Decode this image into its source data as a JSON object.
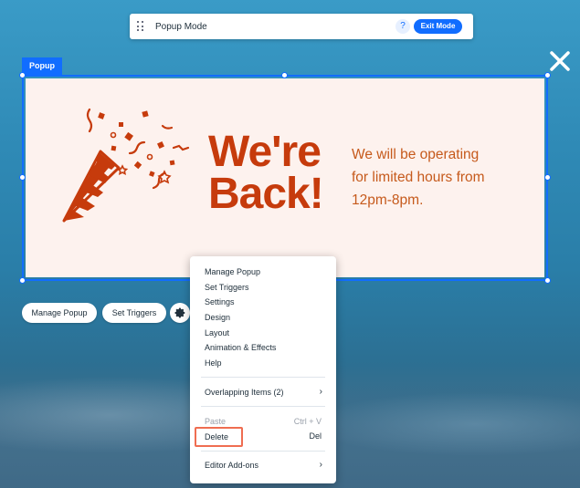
{
  "mode_bar": {
    "title": "Popup Mode",
    "help_label": "?",
    "exit_label": "Exit Mode"
  },
  "popup": {
    "tag_label": "Popup",
    "headline_line1": "We're",
    "headline_line2": "Back!",
    "body_line1": "We will be operating",
    "body_line2": "for limited hours from",
    "body_line3": "12pm-8pm.",
    "illustration": "party-popper-confetti",
    "background_color": "#fdf2ee",
    "accent_color": "#c63b0c"
  },
  "actions": {
    "manage_popup_label": "Manage Popup",
    "set_triggers_label": "Set Triggers",
    "icons": [
      "gear-icon",
      "layout-icon",
      "animation-icon",
      "arrow-icon",
      "help-icon"
    ]
  },
  "context_menu": {
    "items": [
      {
        "label": "Manage Popup"
      },
      {
        "label": "Set Triggers"
      },
      {
        "label": "Settings"
      },
      {
        "label": "Design"
      },
      {
        "label": "Layout"
      },
      {
        "label": "Animation & Effects"
      },
      {
        "label": "Help"
      }
    ],
    "overlapping_label": "Overlapping Items (2)",
    "paste_label": "Paste",
    "paste_shortcut": "Ctrl + V",
    "delete_label": "Delete",
    "delete_shortcut": "Del",
    "addons_label": "Editor Add-ons"
  },
  "colors": {
    "brand_blue": "#116dff",
    "highlight": "#ef6d51"
  }
}
